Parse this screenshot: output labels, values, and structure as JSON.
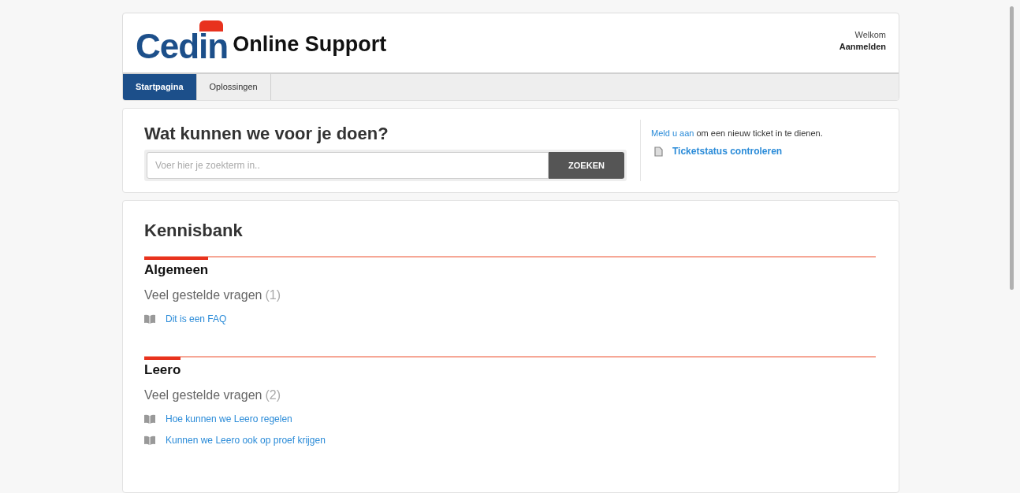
{
  "header": {
    "logo": "Cedin",
    "title": "Online Support",
    "greeting": "Welkom",
    "login_link": "Aanmelden"
  },
  "tabs": [
    {
      "label": "Startpagina",
      "selected": true
    },
    {
      "label": "Oplossingen",
      "selected": false
    }
  ],
  "search": {
    "heading": "Wat kunnen we voor je doen?",
    "placeholder": "Voer hier je zoekterm in..",
    "button": "ZOEKEN"
  },
  "ticket_panel": {
    "signin_link": "Meld u aan",
    "signin_text": "om een nieuw ticket in te dienen.",
    "status_link": "Ticketstatus controleren"
  },
  "knowledge_base": {
    "heading": "Kennisbank",
    "sections": [
      {
        "title": "Algemeen",
        "category": "Veel gestelde vragen",
        "count": "(1)",
        "articles": [
          "Dit is een FAQ"
        ]
      },
      {
        "title": "Leero",
        "category": "Veel gestelde vragen",
        "count": "(2)",
        "articles": [
          "Hoe kunnen we Leero regelen",
          "Kunnen we Leero ook op proef krijgen"
        ]
      }
    ]
  }
}
